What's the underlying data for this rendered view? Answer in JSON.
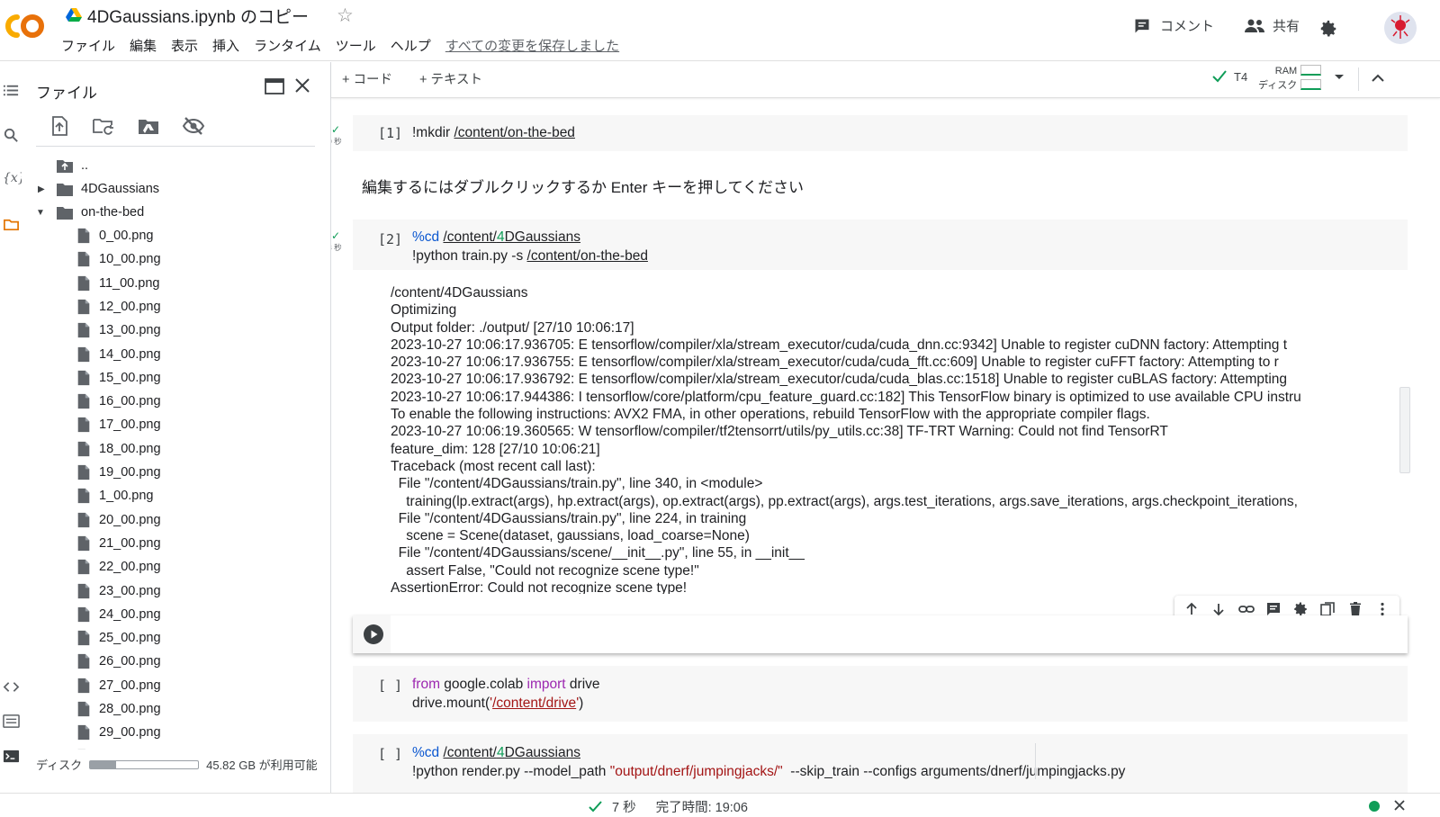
{
  "header": {
    "title": "4DGaussians.ipynb のコピー",
    "menu": [
      "ファイル",
      "編集",
      "表示",
      "挿入",
      "ランタイム",
      "ツール",
      "ヘルプ"
    ],
    "saved_status": "すべての変更を保存しました",
    "comment_label": "コメント",
    "share_label": "共有"
  },
  "file_panel": {
    "title": "ファイル",
    "tree": [
      {
        "label": "..",
        "type": "up"
      },
      {
        "label": "4DGaussians",
        "type": "folder",
        "expanded": false
      },
      {
        "label": "on-the-bed",
        "type": "folder",
        "expanded": true
      },
      {
        "label": "0_00.png",
        "type": "file"
      },
      {
        "label": "10_00.png",
        "type": "file"
      },
      {
        "label": "11_00.png",
        "type": "file"
      },
      {
        "label": "12_00.png",
        "type": "file"
      },
      {
        "label": "13_00.png",
        "type": "file"
      },
      {
        "label": "14_00.png",
        "type": "file"
      },
      {
        "label": "15_00.png",
        "type": "file"
      },
      {
        "label": "16_00.png",
        "type": "file"
      },
      {
        "label": "17_00.png",
        "type": "file"
      },
      {
        "label": "18_00.png",
        "type": "file"
      },
      {
        "label": "19_00.png",
        "type": "file"
      },
      {
        "label": "1_00.png",
        "type": "file"
      },
      {
        "label": "20_00.png",
        "type": "file"
      },
      {
        "label": "21_00.png",
        "type": "file"
      },
      {
        "label": "22_00.png",
        "type": "file"
      },
      {
        "label": "23_00.png",
        "type": "file"
      },
      {
        "label": "24_00.png",
        "type": "file"
      },
      {
        "label": "25_00.png",
        "type": "file"
      },
      {
        "label": "26_00.png",
        "type": "file"
      },
      {
        "label": "27_00.png",
        "type": "file"
      },
      {
        "label": "28_00.png",
        "type": "file"
      },
      {
        "label": "29_00.png",
        "type": "file"
      }
    ],
    "disk_label": "ディスク",
    "disk_available": "45.82 GB が利用可能",
    "disk_used_fraction": 0.24
  },
  "toolbar": {
    "add_code": "+ コード",
    "add_text": "+ テキスト",
    "runtime": "T4",
    "ram_label": "RAM",
    "disk_label": "ディスク"
  },
  "cells": {
    "c1": {
      "exec": "[1]",
      "secs": "0 秒",
      "code_bang": "!mkdir ",
      "code_path": "/content/on-the-bed"
    },
    "text_cell": "編集するにはダブルクリックするか Enter キーを押してください",
    "c2": {
      "exec": "[2]",
      "secs": "8 秒",
      "line1_magic": "%cd",
      "line1_path_a": "/content/",
      "line1_path_num": "4",
      "line1_path_b": "DGaussians",
      "line2_a": "!python train.py -s ",
      "line2_path": "/content/on-the-bed",
      "output": [
        "/content/4DGaussians",
        "Optimizing",
        "Output folder: ./output/ [27/10 10:06:17]",
        "2023-10-27 10:06:17.936705: E tensorflow/compiler/xla/stream_executor/cuda/cuda_dnn.cc:9342] Unable to register cuDNN factory: Attempting t",
        "2023-10-27 10:06:17.936755: E tensorflow/compiler/xla/stream_executor/cuda/cuda_fft.cc:609] Unable to register cuFFT factory: Attempting to r",
        "2023-10-27 10:06:17.936792: E tensorflow/compiler/xla/stream_executor/cuda/cuda_blas.cc:1518] Unable to register cuBLAS factory: Attempting",
        "2023-10-27 10:06:17.944386: I tensorflow/core/platform/cpu_feature_guard.cc:182] This TensorFlow binary is optimized to use available CPU instru",
        "To enable the following instructions: AVX2 FMA, in other operations, rebuild TensorFlow with the appropriate compiler flags.",
        "2023-10-27 10:06:19.360565: W tensorflow/compiler/tf2tensorrt/utils/py_utils.cc:38] TF-TRT Warning: Could not find TensorRT",
        "feature_dim: 128 [27/10 10:06:21]",
        "Traceback (most recent call last):",
        "  File \"/content/4DGaussians/train.py\", line 340, in <module>",
        "    training(lp.extract(args), hp.extract(args), op.extract(args), pp.extract(args), args.test_iterations, args.save_iterations, args.checkpoint_iterations,",
        "  File \"/content/4DGaussians/train.py\", line 224, in training",
        "    scene = Scene(dataset, gaussians, load_coarse=None)",
        "  File \"/content/4DGaussians/scene/__init__.py\", line 55, in __init__",
        "    assert False, \"Could not recognize scene type!\"",
        "AssertionError: Could not recognize scene type!"
      ]
    },
    "c4": {
      "exec": "[ ]",
      "kw_from": "from",
      "mod": " google.colab ",
      "kw_import": "import",
      "name": " drive",
      "line2_a": "drive.mount(",
      "line2_str_q1": "'",
      "line2_str": "/content/drive",
      "line2_str_q2": "'",
      "line2_b": ")"
    },
    "c5": {
      "exec": "[ ]",
      "line1_magic": "%cd",
      "line1_path_a": "/content/",
      "line1_path_num": "4",
      "line1_path_b": "DGaussians",
      "line2_a": "!python render.py --model_path ",
      "line2_str": "\"output/dnerf/jumpingjacks/\"",
      "line2_b": "  --skip_train --configs arguments/dnerf/jumpingjacks.py"
    }
  },
  "status_bar": {
    "elapsed": "7 秒",
    "completed": "完了時間: 19:06"
  }
}
